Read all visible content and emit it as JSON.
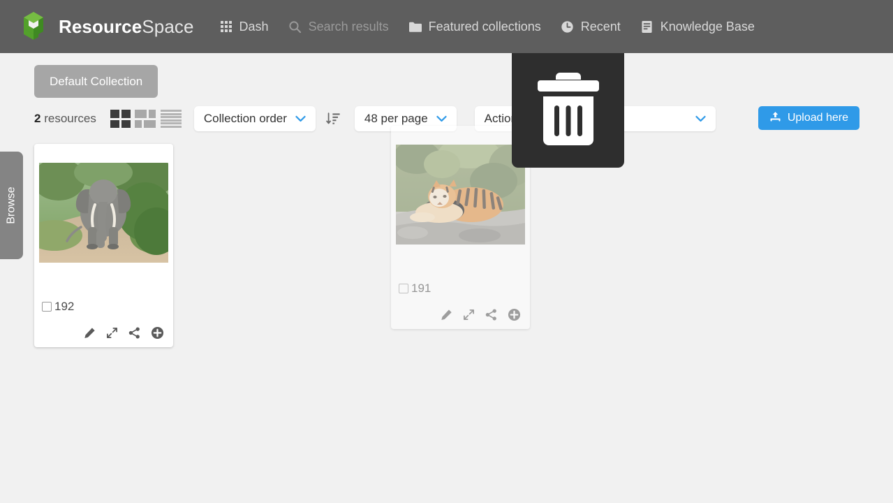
{
  "header": {
    "brand_bold": "Resource",
    "brand_light": "Space",
    "logo_icon": "resourcespace-cube-logo",
    "nav": [
      {
        "label": "Dash",
        "icon": "grid-icon",
        "dim": false
      },
      {
        "label": "Search results",
        "icon": "search-icon",
        "dim": true
      },
      {
        "label": "Featured collections",
        "icon": "folder-icon",
        "dim": false
      },
      {
        "label": "Recent",
        "icon": "clock-icon",
        "dim": false
      },
      {
        "label": "Knowledge Base",
        "icon": "book-icon",
        "dim": false
      }
    ]
  },
  "browse_tab": {
    "label": "Browse"
  },
  "collection_tab": {
    "label": "Default Collection"
  },
  "toolbar": {
    "count_number": "2",
    "count_label": "resources",
    "view_modes": [
      {
        "name": "large-grid-view",
        "active": true
      },
      {
        "name": "mixed-grid-view",
        "active": false
      },
      {
        "name": "list-view",
        "active": false
      }
    ],
    "order_select": {
      "value": "Collection order",
      "icon": "chevron-down-icon"
    },
    "sort_direction": {
      "icon": "sort-descending-icon"
    },
    "perpage_select": {
      "value": "48 per page",
      "icon": "chevron-down-icon"
    },
    "actions_select": {
      "value": "Actions...",
      "icon": "chevron-down-icon"
    },
    "upload_button": {
      "label": "Upload here",
      "icon": "upload-icon"
    }
  },
  "resources": [
    {
      "id": "192",
      "thumbnail_alt": "elephant-on-dirt-road",
      "dragging": false,
      "actions": [
        {
          "name": "edit-icon"
        },
        {
          "name": "expand-icon"
        },
        {
          "name": "share-icon"
        },
        {
          "name": "add-to-collection-icon"
        }
      ]
    },
    {
      "id": "191",
      "thumbnail_alt": "tiger-resting-on-rock",
      "dragging": true,
      "actions": [
        {
          "name": "edit-icon"
        },
        {
          "name": "expand-icon"
        },
        {
          "name": "share-icon"
        },
        {
          "name": "add-to-collection-icon"
        }
      ]
    }
  ],
  "drop_overlay": {
    "icon": "trash-icon",
    "tooltip": "Delete"
  },
  "colors": {
    "header_bg": "#5e5e5e",
    "page_bg": "#f1f1f1",
    "accent_blue": "#2f9ae8",
    "logo_green": "#5aa52b",
    "tab_grey": "#a6a6a6",
    "overlay_dark": "#2e2e2e"
  }
}
